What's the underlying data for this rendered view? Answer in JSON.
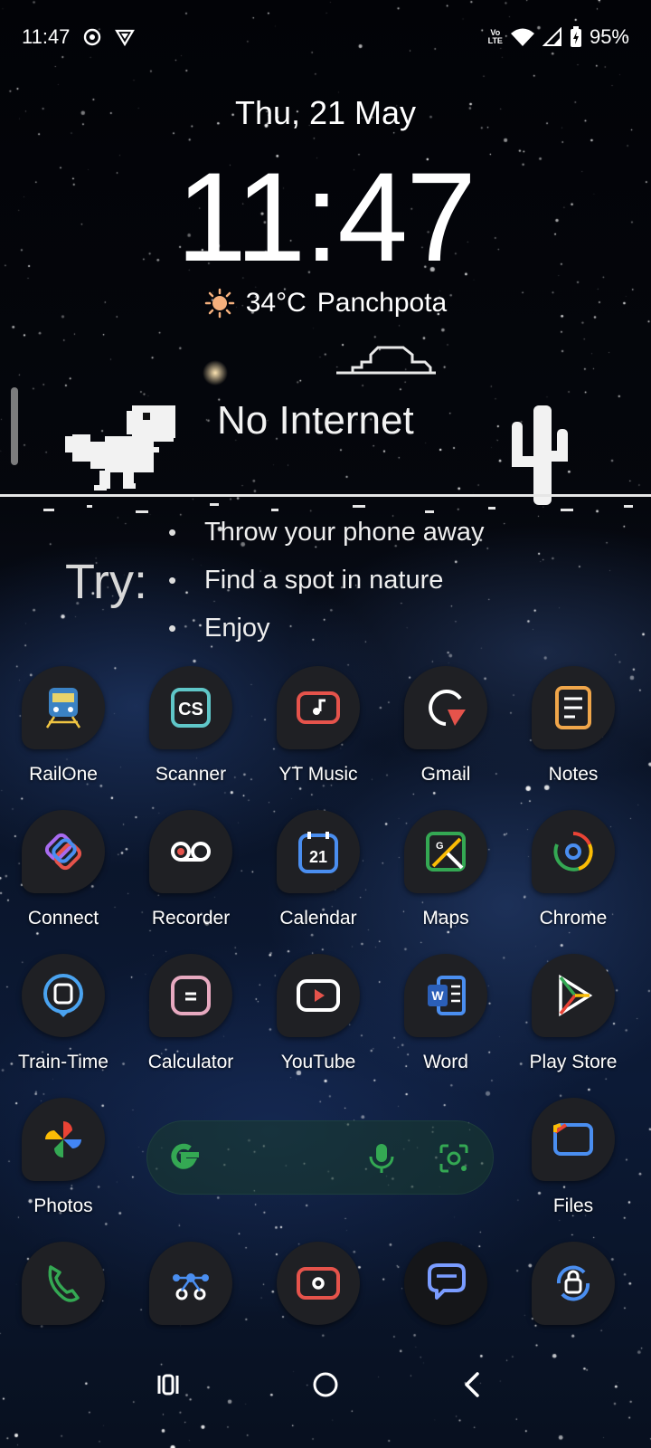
{
  "status_bar": {
    "time": "11:47",
    "network_label": "Vo LTE",
    "battery": "95%"
  },
  "lockclock": {
    "date": "Thu, 21 May",
    "time": "11:47",
    "temperature": "34°C",
    "location": "Panchpota"
  },
  "widget": {
    "title": "No Internet",
    "try_label": "Try:",
    "suggestions": [
      "Throw your phone away",
      "Find a spot in nature",
      "Enjoy"
    ]
  },
  "apps": {
    "row1": [
      "RailOne",
      "Scanner",
      "YT Music",
      "Gmail",
      "Notes"
    ],
    "row2": [
      "Connect",
      "Recorder",
      "Calendar",
      "Maps",
      "Chrome"
    ],
    "row3": [
      "Train-Time",
      "Calculator",
      "YouTube",
      "Word",
      "Play Store"
    ],
    "row4": [
      "Photos",
      "Files"
    ]
  },
  "dock": [
    "phone-icon",
    "connections-icon",
    "camera-icon",
    "messages-icon",
    "secure-folder-icon"
  ],
  "calendar_day": "21",
  "colors": {
    "sun": "#f5b07d",
    "google_green": "#34a853",
    "google_blue": "#4285f4",
    "google_red": "#ea4335",
    "google_yellow": "#fbbc05"
  }
}
